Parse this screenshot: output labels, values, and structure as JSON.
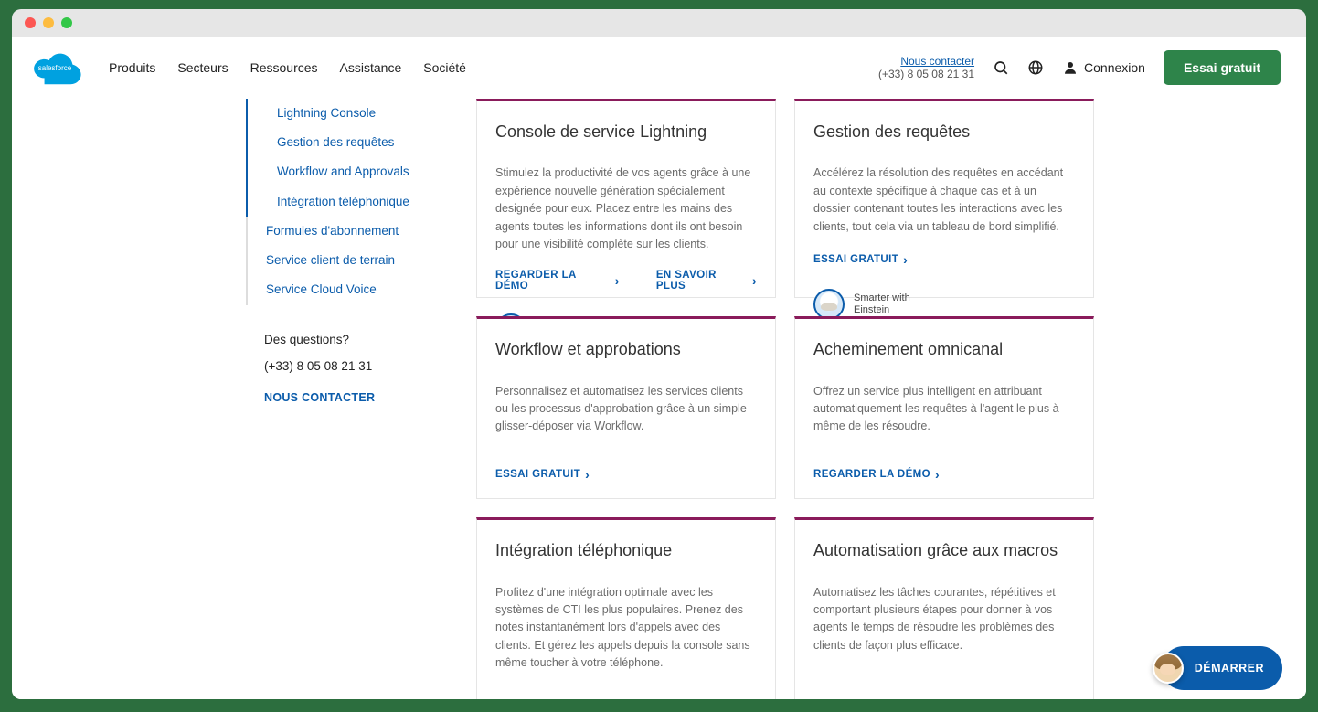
{
  "header": {
    "nav": [
      "Produits",
      "Secteurs",
      "Ressources",
      "Assistance",
      "Société"
    ],
    "contact_label": "Nous contacter",
    "phone": "(+33) 8 05 08 21 31",
    "login_label": "Connexion",
    "trial_label": "Essai gratuit",
    "logo_text": "salesforce"
  },
  "sidebar": {
    "items": [
      "Lightning Console",
      "Gestion des requêtes",
      "Workflow and Approvals",
      "Intégration téléphonique"
    ],
    "secondary": [
      "Formules d'abonnement",
      "Service client de terrain",
      "Service Cloud Voice"
    ],
    "questions_label": "Des questions?",
    "phone": "(+33) 8 05 08 21 31",
    "cta": "NOUS CONTACTER"
  },
  "cards": [
    {
      "title": "Console de service Lightning",
      "desc": "Stimulez la productivité de vos agents grâce à une expérience nouvelle génération spécialement designée pour eux. Placez entre les mains des agents toutes les informations dont ils ont besoin pour une visibilité complète sur les clients.",
      "ctas": [
        "REGARDER LA DÉMO",
        "EN SAVOIR PLUS"
      ],
      "einstein": true
    },
    {
      "title": "Gestion des requêtes",
      "desc": "Accélérez la résolution des requêtes en accédant au contexte spécifique à chaque cas et à un dossier contenant toutes les interactions avec les clients, tout cela via un tableau de bord simplifié.",
      "ctas": [
        "ESSAI GRATUIT"
      ],
      "einstein": true
    },
    {
      "title": "Workflow et approbations",
      "desc": "Personnalisez et automatisez les services clients ou les processus d'approbation grâce à un simple glisser-déposer via Workflow.",
      "ctas": [
        "ESSAI GRATUIT"
      ],
      "einstein": false
    },
    {
      "title": "Acheminement omnicanal",
      "desc": "Offrez un service plus intelligent en attribuant automatiquement les requêtes à l'agent le plus à même de les résoudre.",
      "ctas": [
        "REGARDER LA DÉMO"
      ],
      "einstein": false
    },
    {
      "title": "Intégration téléphonique",
      "desc": "Profitez d'une intégration optimale avec les systèmes de CTI les plus populaires. Prenez des notes instantanément lors d'appels avec des clients. Et gérez les appels depuis la console sans même toucher à votre téléphone.",
      "ctas": [],
      "einstein": false
    },
    {
      "title": "Automatisation grâce aux macros",
      "desc": "Automatisez les tâches courantes, répétitives et comportant plusieurs étapes pour donner à vos agents le temps de résoudre les problèmes des clients de façon plus efficace.",
      "ctas": [],
      "einstein": false
    }
  ],
  "einstein_text": "Smarter with Einstein",
  "chat_label": "DÉMARRER"
}
